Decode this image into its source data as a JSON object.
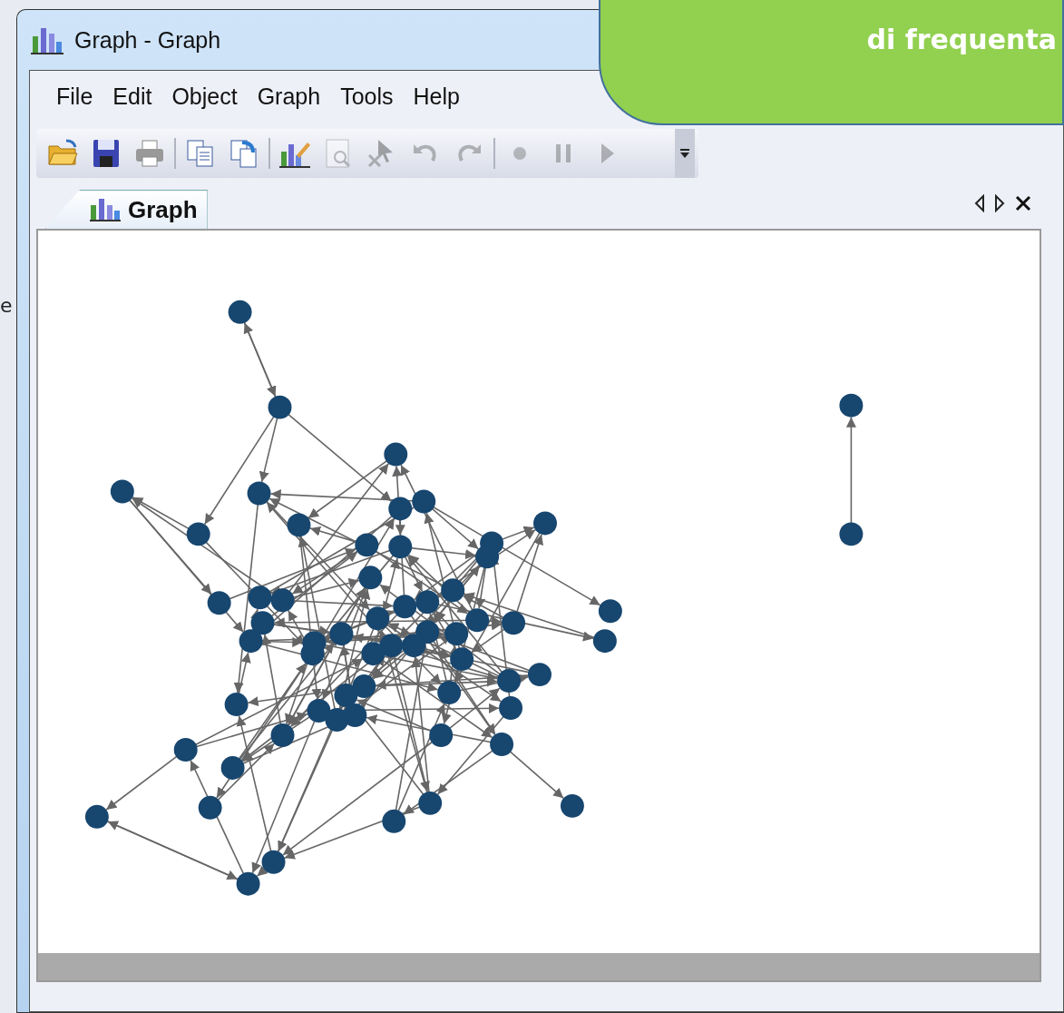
{
  "background_text": "e",
  "window": {
    "title": "Graph - Graph"
  },
  "menu": [
    {
      "label": "File"
    },
    {
      "label": "Edit"
    },
    {
      "label": "Object"
    },
    {
      "label": "Graph"
    },
    {
      "label": "Tools"
    },
    {
      "label": "Help"
    }
  ],
  "toolbar": [
    {
      "kind": "open",
      "disabled": false
    },
    {
      "kind": "save",
      "disabled": false
    },
    {
      "kind": "print",
      "disabled": false
    },
    {
      "kind": "separator"
    },
    {
      "kind": "copy",
      "disabled": false
    },
    {
      "kind": "paste",
      "disabled": false
    },
    {
      "kind": "separator"
    },
    {
      "kind": "chart-edit",
      "disabled": false
    },
    {
      "kind": "preview",
      "disabled": true
    },
    {
      "kind": "pointer",
      "disabled": true
    },
    {
      "kind": "undo",
      "disabled": true
    },
    {
      "kind": "redo",
      "disabled": true
    },
    {
      "kind": "separator"
    },
    {
      "kind": "record",
      "disabled": true
    },
    {
      "kind": "pause",
      "disabled": true
    },
    {
      "kind": "play",
      "disabled": true
    }
  ],
  "tabs": [
    {
      "label": "Graph",
      "selected": true
    }
  ],
  "callout": {
    "text": "di frequenta"
  }
}
